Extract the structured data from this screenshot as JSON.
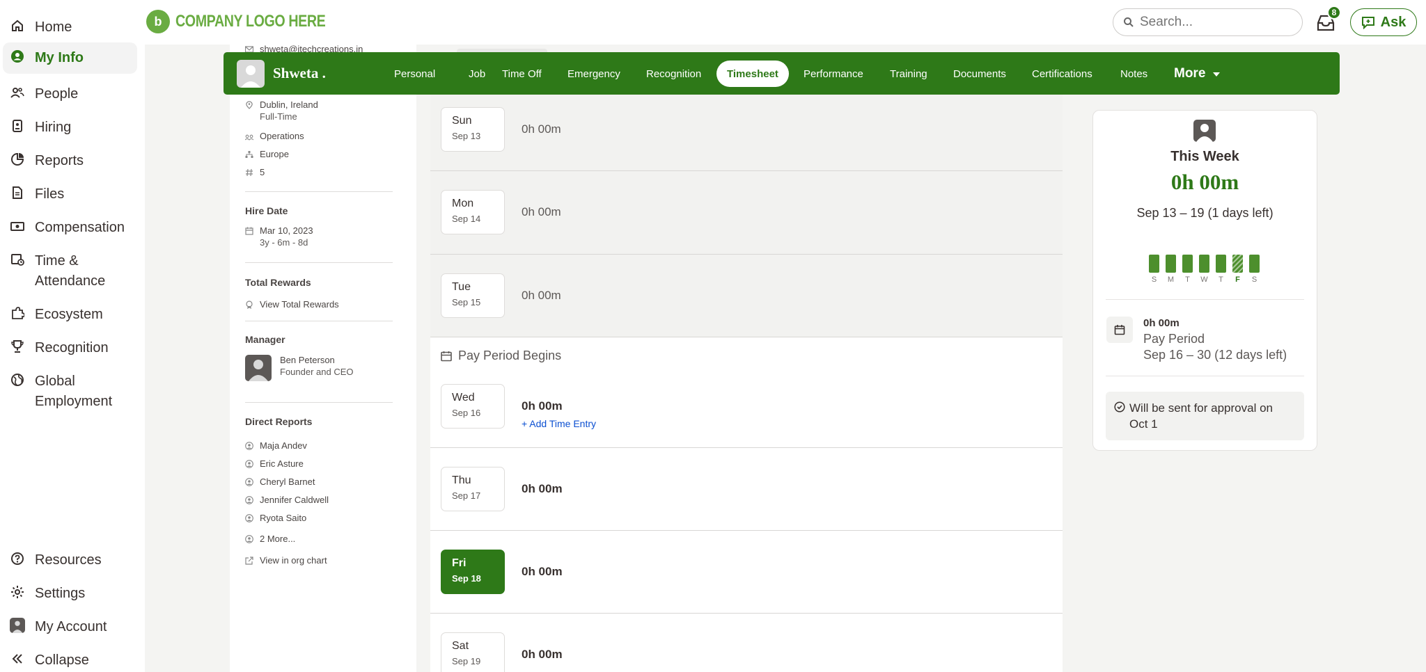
{
  "nav": {
    "items": [
      {
        "label": "Home",
        "icon": "home-icon"
      },
      {
        "label": "My Info",
        "icon": "person-circle-icon",
        "active": true
      },
      {
        "label": "People",
        "icon": "people-icon"
      },
      {
        "label": "Hiring",
        "icon": "hiring-icon"
      },
      {
        "label": "Reports",
        "icon": "reports-icon"
      },
      {
        "label": "Files",
        "icon": "files-icon"
      },
      {
        "label": "Compensation",
        "icon": "compensation-icon"
      },
      {
        "label": "Time & Attendance",
        "icon": "time-attendance-icon"
      },
      {
        "label": "Ecosystem",
        "icon": "puzzle-icon"
      },
      {
        "label": "Recognition",
        "icon": "trophy-icon"
      },
      {
        "label": "Global Employment",
        "icon": "globe-icon"
      }
    ],
    "bottom": [
      {
        "label": "Resources",
        "icon": "help-icon"
      },
      {
        "label": "Settings",
        "icon": "gear-icon"
      },
      {
        "label": "My Account",
        "icon": "avatar-icon"
      },
      {
        "label": "Collapse",
        "icon": "double-chevron-left-icon"
      }
    ]
  },
  "topbar": {
    "logo_text": "COMPANY LOGO HERE",
    "search_placeholder": "Search...",
    "inbox_count": "8",
    "ask_label": "Ask"
  },
  "header": {
    "employee_name": "Shweta .",
    "tabs": [
      "Personal",
      "Job",
      "Time Off",
      "Emergency",
      "Recognition",
      "Timesheet",
      "Performance",
      "Training",
      "Documents",
      "Certifications",
      "Notes"
    ],
    "active_tab": "Timesheet",
    "more_label": "More"
  },
  "profile": {
    "email": "shweta@itechcreations.in",
    "location": "Dublin, Ireland",
    "employment_type": "Full-Time",
    "department": "Operations",
    "division": "Europe",
    "employee_number": "5",
    "hire_date_heading": "Hire Date",
    "hire_date": "Mar 10, 2023",
    "tenure": "3y - 6m - 8d",
    "total_rewards_heading": "Total Rewards",
    "view_total_rewards": "View Total Rewards",
    "manager_heading": "Manager",
    "manager_name": "Ben Peterson",
    "manager_title": "Founder and CEO",
    "direct_reports_heading": "Direct Reports",
    "direct_reports": [
      "Maja Andev",
      "Eric Asture",
      "Cheryl Barnet",
      "Jennifer Caldwell",
      "Ryota Saito"
    ],
    "more_reports": "2 More...",
    "org_chart_link": "View in org chart"
  },
  "timesheet": {
    "days": [
      {
        "name": "Sun",
        "date": "Sep 13",
        "hours": "0h 00m"
      },
      {
        "name": "Mon",
        "date": "Sep 14",
        "hours": "0h 00m"
      },
      {
        "name": "Tue",
        "date": "Sep 15",
        "hours": "0h 00m"
      },
      {
        "name": "Wed",
        "date": "Sep 16",
        "hours": "0h 00m"
      },
      {
        "name": "Thu",
        "date": "Sep 17",
        "hours": "0h 00m"
      },
      {
        "name": "Fri",
        "date": "Sep 18",
        "hours": "0h 00m",
        "today": true
      },
      {
        "name": "Sat",
        "date": "Sep 19",
        "hours": "0h 00m"
      }
    ],
    "pay_period_begins": "Pay Period Begins",
    "add_time_entry": "+ Add Time Entry"
  },
  "week_summary": {
    "title": "This Week",
    "total": "0h 00m",
    "range": "Sep 13 – 19 (1 days left)",
    "bar_labels": [
      "S",
      "M",
      "T",
      "W",
      "T",
      "F",
      "S"
    ],
    "current_day_index": 5,
    "pay_period_hours": "0h 00m",
    "pay_period_label": "Pay Period",
    "pay_period_range": "Sep 16 – 30 (12 days left)",
    "approval_note": "Will be sent for approval on Oct 1"
  },
  "colors": {
    "brand_green": "#2e7918",
    "logo_green": "#6aac42",
    "link_blue": "#0b4fd1"
  }
}
